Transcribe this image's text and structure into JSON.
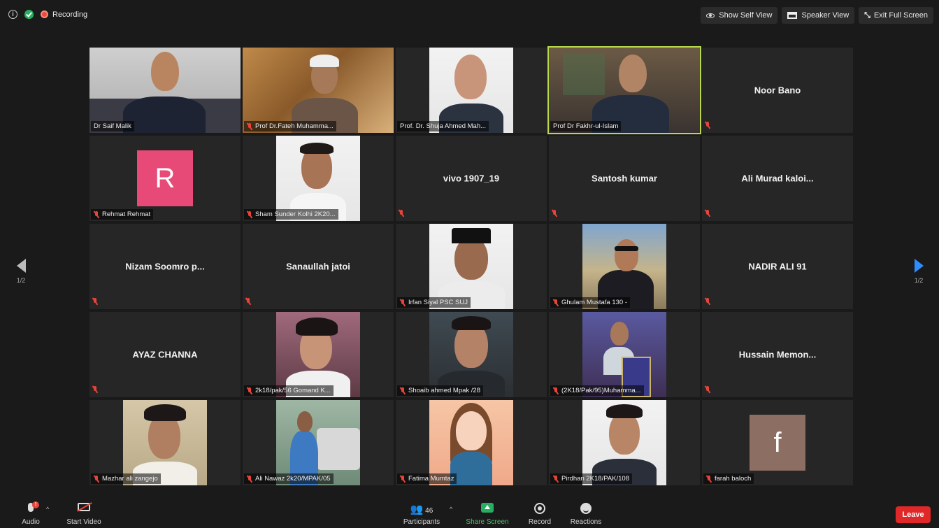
{
  "status": {
    "recording_label": "Recording"
  },
  "view_controls": {
    "self_view": "Show Self View",
    "speaker_view": "Speaker View",
    "exit_full": "Exit Full Screen"
  },
  "pagination": {
    "left": "1/2",
    "right": "1/2"
  },
  "tiles": [
    {
      "name": "Dr Saif Malik",
      "type": "photo",
      "muted": false
    },
    {
      "name": "Prof Dr.Fateh Muhamma...",
      "type": "photo",
      "muted": true
    },
    {
      "name": "Prof. Dr. Shuja Ahmed Mah...",
      "type": "pic",
      "muted": false
    },
    {
      "name": "Prof Dr Fakhr-ul-Islam",
      "type": "photo",
      "muted": false,
      "active": true
    },
    {
      "name": "Noor Bano",
      "type": "name",
      "muted": true
    },
    {
      "name": "Rehmat Rehmat",
      "type": "avatar",
      "avatar_letter": "R",
      "avatar_color": "#e84a78",
      "muted": true
    },
    {
      "name": "Sham Sunder Kolhi 2K20...",
      "type": "pic",
      "muted": true
    },
    {
      "name": "vivo 1907_19",
      "type": "name",
      "muted": true
    },
    {
      "name": "Santosh kumar",
      "type": "name",
      "muted": true
    },
    {
      "name": "Ali Murad kaloi...",
      "type": "name",
      "muted": true
    },
    {
      "name": "Nizam Soomro p...",
      "type": "name",
      "muted": true
    },
    {
      "name": "Sanaullah jatoi",
      "type": "name",
      "muted": true
    },
    {
      "name": "Irfan Siyal PSC SUJ",
      "type": "pic",
      "muted": true
    },
    {
      "name": "Ghulam Mustafa 130 -",
      "type": "pic",
      "muted": true
    },
    {
      "name": "NADIR ALI 91",
      "type": "name",
      "muted": true
    },
    {
      "name": "AYAZ CHANNA",
      "type": "name",
      "muted": true
    },
    {
      "name": "2k18/pak/56 Gomand K...",
      "type": "pic",
      "muted": true
    },
    {
      "name": "Shoaib ahmed Mpak /28",
      "type": "pic",
      "muted": true
    },
    {
      "name": "(2K18/Pak/95)Muhamma...",
      "type": "pic",
      "muted": true
    },
    {
      "name": "Hussain Memon...",
      "type": "name",
      "muted": true
    },
    {
      "name": "Mazhar ali zangejo",
      "type": "pic",
      "muted": true
    },
    {
      "name": "Ali Nawaz 2k20/MPAK/05",
      "type": "pic",
      "muted": true
    },
    {
      "name": "Fatima Mumtaz",
      "type": "pic",
      "muted": true
    },
    {
      "name": "Pirdhan 2K18/PAK/108",
      "type": "pic",
      "muted": true
    },
    {
      "name": "farah baloch",
      "type": "avatar",
      "avatar_letter": "f",
      "avatar_color": "#8c6e62",
      "muted": true
    }
  ],
  "toolbar": {
    "audio": "Audio",
    "start_video": "Start Video",
    "participants_count": "46",
    "participants": "Participants",
    "share_screen": "Share Screen",
    "record": "Record",
    "reactions": "Reactions",
    "leave": "Leave"
  }
}
